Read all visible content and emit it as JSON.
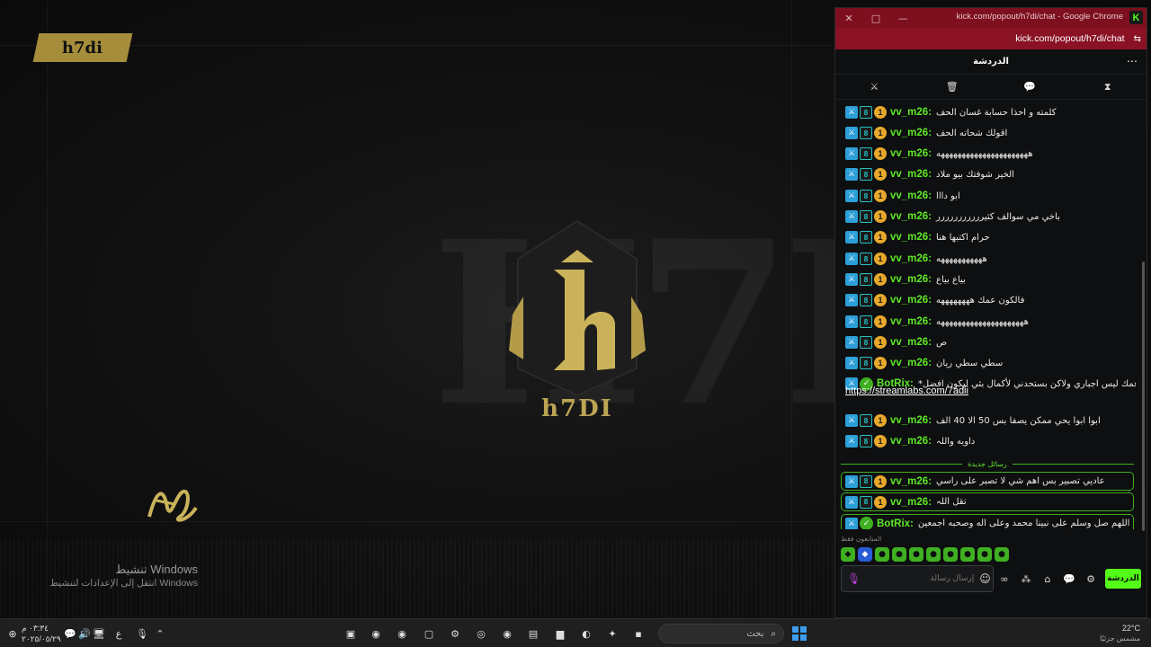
{
  "stream": {
    "logo_text": "h7di",
    "ghost_text": "H7DI",
    "emblem_caption": "h7DI",
    "activation_title": "تنشيط Windows",
    "activation_subtitle": "انتقل إلى الإعدادات لتنشيط Windows"
  },
  "window": {
    "title": "kick.com/popout/h7di/chat - Google Chrome",
    "url": "kick.com/popout/h7di/chat",
    "close": "✕",
    "maximize": "□",
    "minimize": "—",
    "kick_badge": "K"
  },
  "chat": {
    "header_title": "الدردشة",
    "menu": "⋯",
    "messages": [
      {
        "user": "vv_m26:",
        "text": "كلمته و احذا حسابة غسان الحف",
        "badges": "mod-vip-sub"
      },
      {
        "user": "vv_m26:",
        "text": "اقولك شحاته الحف",
        "badges": "mod-vip-sub"
      },
      {
        "user": "vv_m26:",
        "text": "ههههههههههههههههههههههه",
        "badges": "mod-vip-sub"
      },
      {
        "user": "vv_m26:",
        "text": "الخير شوفتك بيو ملاد",
        "badges": "mod-vip-sub"
      },
      {
        "user": "vv_m26:",
        "text": "ابو دااا",
        "badges": "mod-vip-sub"
      },
      {
        "user": "vv_m26:",
        "text": "باخي مي سوالف كثيررررررررررر",
        "badges": "mod-vip-sub"
      },
      {
        "user": "vv_m26:",
        "text": "حرام اكتبها هنا",
        "badges": "mod-vip-sub"
      },
      {
        "user": "vv_m26:",
        "text": "هههههههههههه",
        "badges": "mod-vip-sub"
      },
      {
        "user": "vv_m26:",
        "text": "بياع بياع",
        "badges": "mod-vip-sub"
      },
      {
        "user": "vv_m26:",
        "text": "فالكون عمك ههههههههه",
        "badges": "mod-vip-sub"
      },
      {
        "user": "vv_m26:",
        "text": "هههههههههههههههههههههه",
        "badges": "mod-vip-sub"
      },
      {
        "user": "vv_m26:",
        "text": "ص",
        "badges": "mod-vip-sub"
      },
      {
        "user": "vv_m26:",
        "text": "سطي سطي ريان",
        "badges": "mod-vip-sub"
      },
      {
        "user": "BotRix:",
        "text": "*دعمك ليس اجباري ولاكن بستحدني لأكمال بثي ليكون افضل",
        "badges": "mod-verified"
      },
      {
        "user": "vv_m26:",
        "text": "ابوا ابوا يحي ممكن يصفا بس 50 الا 40 الف",
        "badges": "mod-vip-sub"
      },
      {
        "user": "vv_m26:",
        "text": "داويه واللہ",
        "badges": "mod-vip-sub"
      }
    ],
    "link": "https://streamlabs.com/7adii",
    "new_messages_label": "رسائل جديدة",
    "new_messages": [
      {
        "user": "vv_m26:",
        "text": "عاديي تصبير بس اهم شي لا تصبر على راسي",
        "badges": "mod-vip-sub"
      },
      {
        "user": "vv_m26:",
        "text": "تقل اللہ",
        "badges": "mod-vip-sub"
      },
      {
        "user": "BotRix:",
        "text": "اللهم صل وسلم على نبينا محمد وعلى اله وصحبه اجمعين",
        "badges": "mod-verified"
      }
    ],
    "emote_label": "المتابعون فقط",
    "input_placeholder": "إرسال رسالة",
    "send_label": "الدردشة"
  },
  "taskbar": {
    "search_text": "بحث",
    "weather_temp": "22°C",
    "weather_desc": "مشمس جزئيًا",
    "clock_time": "٠٣:٣٤ م",
    "clock_date": "٢٠٢٥/٠٥/٢٩",
    "lang": "ع"
  },
  "colors": {
    "accent": "#53fc18",
    "username": "#5ee828",
    "titlebar": "#7d0f1e",
    "gold": "#bba453"
  }
}
